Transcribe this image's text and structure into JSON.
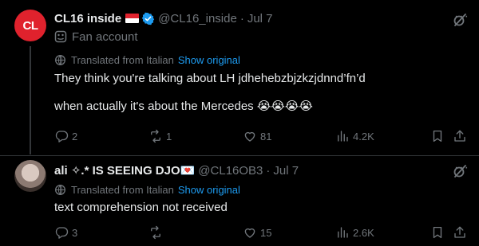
{
  "tweets": [
    {
      "display_name": "CL16 inside",
      "avatar_text": "CL",
      "handle": "@CL16_inside",
      "separator": "·",
      "date": "Jul 7",
      "account_label": "Fan account",
      "translated_from": "Translated from Italian",
      "show_original": "Show original",
      "text_lines": [
        "They think you're talking about LH jdhehebzbjzkzjdnnd’fn’d",
        "when actually it's about the Mercedes 😭😭😭😭"
      ],
      "replies": "2",
      "retweets": "1",
      "likes": "81",
      "views": "4.2K"
    },
    {
      "display_name": "ali ✧.* IS SEEING DJO💌",
      "handle": "@CL16OB3",
      "separator": "·",
      "date": "Jul 7",
      "translated_from": "Translated from Italian",
      "show_original": "Show original",
      "text": "text comprehension not received",
      "replies": "3",
      "retweets": "",
      "likes": "15",
      "views": "2.6K"
    }
  ],
  "colors": {
    "background": "#000000",
    "text": "#e7e9ea",
    "muted": "#71767b",
    "link": "#1d9bf0",
    "verified": "#1d9bf0",
    "brand_red": "#e0222d"
  },
  "icons": [
    "verified-badge-icon",
    "grok-icon",
    "more-icon",
    "fan-account-icon",
    "translate-icon",
    "reply-icon",
    "retweet-icon",
    "like-icon",
    "views-icon",
    "bookmark-icon",
    "share-icon"
  ]
}
